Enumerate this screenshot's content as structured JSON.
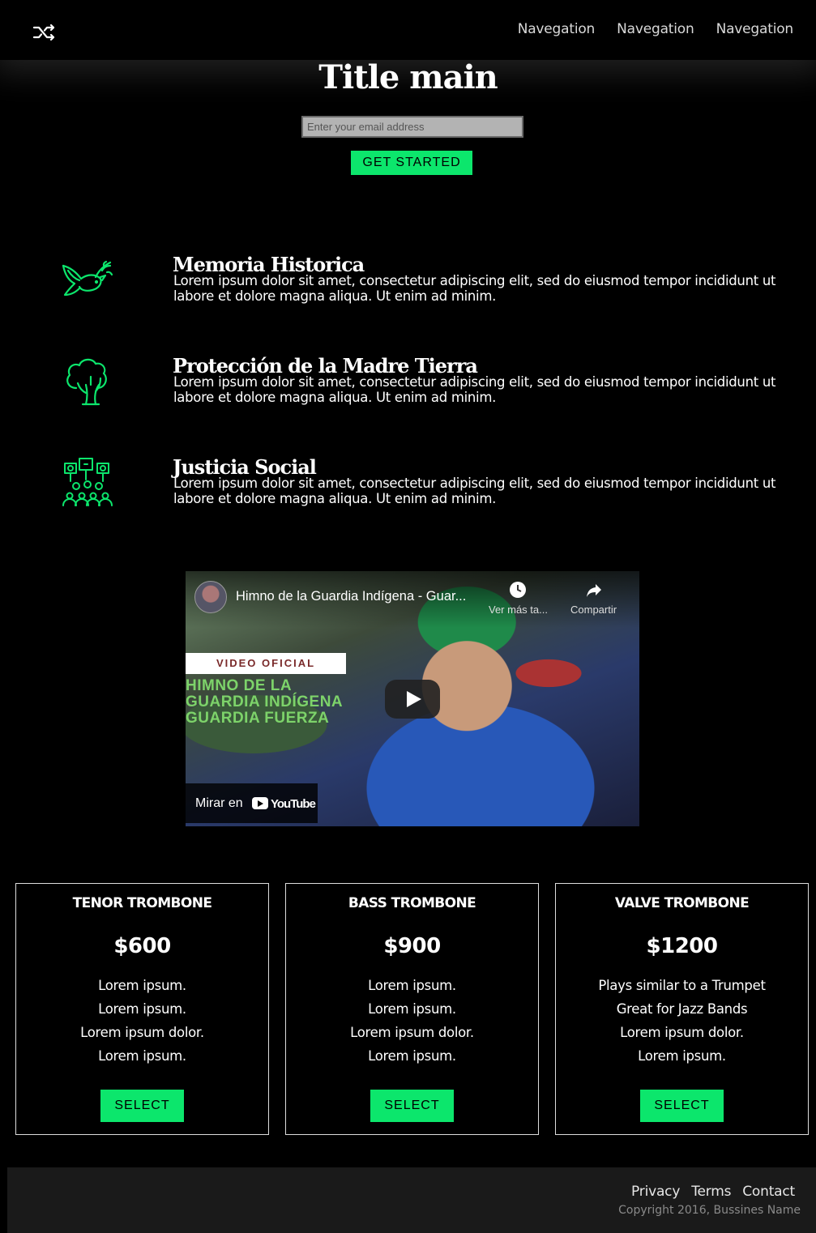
{
  "header": {
    "logo_icon": "shuffle-icon",
    "nav": [
      "Navegation",
      "Navegation",
      "Navegation"
    ]
  },
  "hero": {
    "title": "Title main",
    "email_placeholder": "Enter your email address",
    "cta_label": "GET STARTED"
  },
  "features": [
    {
      "icon": "dove-icon",
      "title": "Memoria Historica",
      "text": "Lorem ipsum dolor sit amet, consectetur adipiscing elit, sed do eiusmod tempor incididunt ut labore et dolore magna aliqua. Ut enim ad minim."
    },
    {
      "icon": "tree-icon",
      "title": "Protección de la Madre Tierra",
      "text": "Lorem ipsum dolor sit amet, consectetur adipiscing elit, sed do eiusmod tempor incididunt ut labore et dolore magna aliqua. Ut enim ad minim."
    },
    {
      "icon": "protest-icon",
      "title": "Justicia Social",
      "text": "Lorem ipsum dolor sit amet, consectetur adipiscing elit, sed do eiusmod tempor incididunt ut labore et dolore magna aliqua. Ut enim ad minim."
    }
  ],
  "video": {
    "title": "Himno de la Guardia Indígena - Guar...",
    "watch_later": "Ver más ta...",
    "share": "Compartir",
    "tag": "VIDEO OFICIAL",
    "headline": [
      "HIMNO DE LA",
      "GUARDIA INDÍGENA",
      "GUARDIA FUERZA"
    ],
    "watch_on": "Mirar en",
    "youtube": "YouTube"
  },
  "pricing": [
    {
      "name": "TENOR TROMBONE",
      "price": "$600",
      "features": [
        "Lorem ipsum.",
        "Lorem ipsum.",
        "Lorem ipsum dolor.",
        "Lorem ipsum."
      ],
      "button": "SELECT"
    },
    {
      "name": "BASS TROMBONE",
      "price": "$900",
      "features": [
        "Lorem ipsum.",
        "Lorem ipsum.",
        "Lorem ipsum dolor.",
        "Lorem ipsum."
      ],
      "button": "SELECT"
    },
    {
      "name": "VALVE TROMBONE",
      "price": "$1200",
      "features": [
        "Plays similar to a Trumpet",
        "Great for Jazz Bands",
        "Lorem ipsum dolor.",
        "Lorem ipsum."
      ],
      "button": "SELECT"
    }
  ],
  "footer": {
    "links": [
      "Privacy",
      "Terms",
      "Contact"
    ],
    "copyright": "Copyright 2016, Bussines Name"
  },
  "colors": {
    "accent": "#0ce66c",
    "background": "#000000",
    "footer": "#1a1a1a"
  }
}
